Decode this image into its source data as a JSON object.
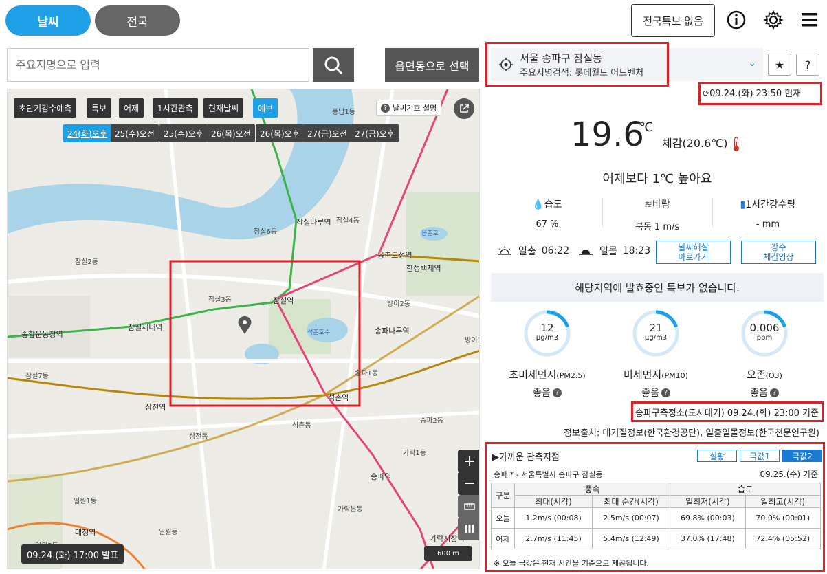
{
  "tabs": {
    "weather": "날씨",
    "nation": "전국"
  },
  "header": {
    "alert_button": "전국특보 없음"
  },
  "search": {
    "placeholder": "주요지명으로 입력",
    "region_button": "읍면동으로 선택"
  },
  "map": {
    "layers": [
      "초단기강수예측",
      "특보",
      "어제",
      "1시간관측",
      "현재날씨",
      "예보"
    ],
    "active_layer": "예보",
    "times": [
      "24(화)오후",
      "25(수)오전",
      "25(수)오후",
      "26(목)오전",
      "26(목)오후",
      "27(금)오전",
      "27(금)오후"
    ],
    "active_time": "24(화)오후",
    "legend_label": "날씨기호 설명",
    "publish_time": "09.24.(화) 17:00 발표",
    "scale": "600 m",
    "stations": [
      "잠실역",
      "잠실나루역",
      "잠실새내역",
      "종합운동장역",
      "석촌역",
      "몽촌토성역",
      "송파나루역",
      "송파역",
      "삼전역",
      "대청역",
      "가락시장역",
      "한성백제역"
    ],
    "areas": [
      "잠실3동",
      "잠실6동",
      "잠실2동",
      "잠실7동",
      "잠실4동",
      "송파1동",
      "송파2동",
      "방이2동",
      "삼전동",
      "석촌동",
      "가락1동",
      "일원1동",
      "일원2동",
      "풍납1동",
      "방이1동",
      "일원동",
      "가락본동"
    ],
    "places": [
      "석촌호수",
      "몽촌호"
    ]
  },
  "location": {
    "name": "서울 송파구 잠실동",
    "search_info": "주요지명검색: 롯데월드 어드벤처",
    "updated": "09.24.(화) 23:50 현재"
  },
  "current": {
    "temperature": "19.6",
    "unit": "℃",
    "feels_like": "체감(20.6℃)",
    "comparison": "어제보다 1℃ 높아요",
    "humidity_label": "습도",
    "humidity_value": "67 %",
    "wind_label": "바람",
    "wind_value": "북동 1 m/s",
    "rain_label": "1시간강수량",
    "rain_value": "- mm",
    "sunrise_label": "일출",
    "sunrise": "06:22",
    "sunset_label": "일몰",
    "sunset": "18:23",
    "guide_button": "날씨해설\n바로가기",
    "rain_video_button": "강수\n체감영상",
    "no_warning": "해당지역에 발효중인 특보가 없습니다."
  },
  "air": {
    "items": [
      {
        "value": "12",
        "unit": "μg/m3",
        "name": "초미세먼지",
        "sub": "(PM2.5)",
        "grade": "좋음",
        "fraction": 0.2
      },
      {
        "value": "21",
        "unit": "μg/m3",
        "name": "미세먼지",
        "sub": "(PM10)",
        "grade": "좋음",
        "fraction": 0.2
      },
      {
        "value": "0.006",
        "unit": "ppm",
        "name": "오존",
        "sub": "(O3)",
        "grade": "좋음",
        "fraction": 0.2
      }
    ],
    "station_time": "송파구측정소(도시대기) 09.24.(화) 23:00 기준",
    "source": "정보출처: 대기질정보(한국환경공단), 일출일몰정보(한국천문연구원)"
  },
  "observation": {
    "title": "▶가까운 관측지점",
    "tabs": [
      "실황",
      "극값1",
      "극값2"
    ],
    "active_tab": "극값2",
    "location": "송파 * - 서울특별시 송파구 잠실동",
    "date": "09.25.(수) 기준",
    "headers": {
      "category": "구분",
      "wind": "풍속",
      "humidity": "습도",
      "max_time": "최대(시각)",
      "max_instant": "최대 순간(시각)",
      "min_daily": "일최저(시각)",
      "max_daily": "일최고(시각)"
    },
    "rows": [
      {
        "label": "오늘",
        "v1": "1.2m/s (00:08)",
        "v2": "2.5m/s (00:07)",
        "v3": "69.8% (00:03)",
        "v4": "70.0% (00:01)"
      },
      {
        "label": "어제",
        "v1": "2.7m/s (11:45)",
        "v2": "5.4m/s (12:49)",
        "v3": "37.0% (17:48)",
        "v4": "72.4% (05:52)"
      }
    ],
    "note": "※ 오늘 극값은 현재 시간을 기준으로 제공됩니다."
  },
  "colors": {
    "accent": "#1fa0e6",
    "highlight": "#e01f26",
    "ring": "#1fa0e6"
  }
}
